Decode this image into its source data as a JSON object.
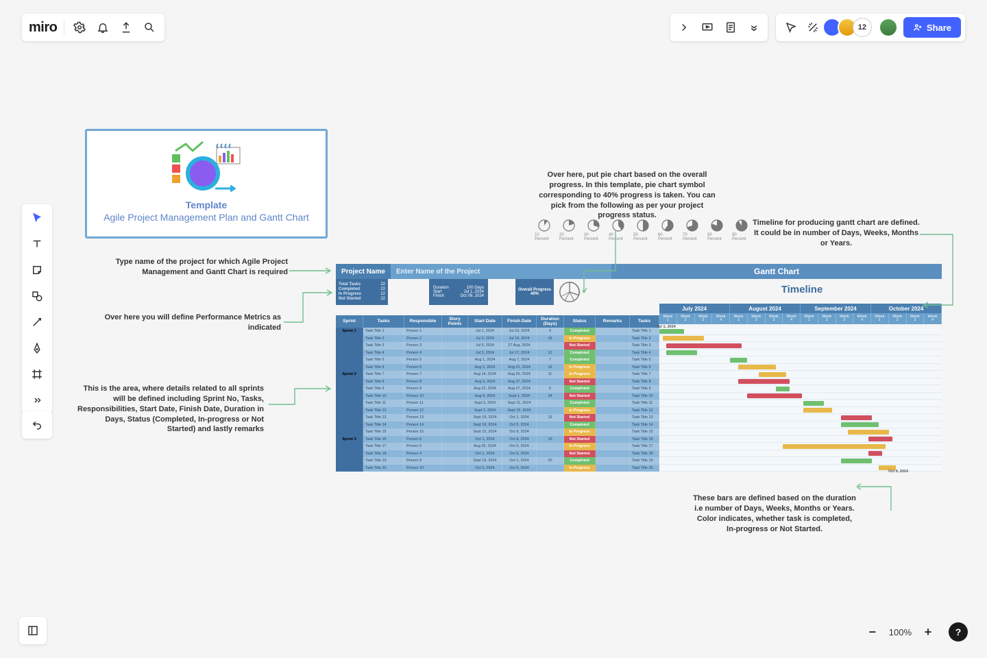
{
  "header": {
    "logo": "miro",
    "share_label": "Share",
    "avatar_overflow": "12"
  },
  "zoom": {
    "percent": "100%"
  },
  "template_card": {
    "title": "Template",
    "subtitle": "Agile Project Management Plan and Gantt Chart"
  },
  "annotations": {
    "project_name": "Type name of the project for which Agile Project Management and Gantt Chart is required",
    "metrics": "Over here you will define Performance Metrics as indicated",
    "sprints": "This is the area, where details related to all sprints will be defined including Sprint No, Tasks, Responsibilities, Start Date, Finish Date, Duration in Days, Status (Completed, In-progress or Not Started) and lastly remarks",
    "pie": "Over here, put pie chart based on the overall progress. In this template, pie chart symbol corresponding to 40% progress is taken. You can pick from the following as per your project progress status.",
    "timeline": "Timeline for producing gantt chart are defined. It could be in number of Days, Weeks, Months or Years.",
    "bars": "These bars are defined based on the duration i.e number of Days, Weeks, Months or Years. Color indicates, whether task is completed, In-progress or Not Started."
  },
  "pie_labels": [
    "10 Percent",
    "20 Percent",
    "30 Percent",
    "40 Percent",
    "50 Percent",
    "60 Percent",
    "70 Percent",
    "80 Percent",
    "90 Percent"
  ],
  "gantt": {
    "project_name_label": "Project Name",
    "project_name_placeholder": "Enter Name of the Project",
    "chart_label": "Gantt Chart",
    "timeline_label": "Timeline",
    "metrics": {
      "total_tasks": {
        "label": "Total Tasks",
        "value": "22"
      },
      "completed": {
        "label": "Completed",
        "value": "22"
      },
      "in_progress": {
        "label": "In Progress",
        "value": "22"
      },
      "not_started": {
        "label": "Not Started",
        "value": "22"
      }
    },
    "duration": {
      "label": "Duration",
      "value": "100 Days",
      "start_l": "Start",
      "start_v": "Jul 1, 2024",
      "finish_l": "Finish",
      "finish_v": "Oct 09, 2024"
    },
    "overall": {
      "label": "Overall Progress",
      "value": "40%"
    },
    "months": [
      {
        "label": "July 2024",
        "weeks": 4
      },
      {
        "label": "August 2024",
        "weeks": 4
      },
      {
        "label": "September 2024",
        "weeks": 4
      },
      {
        "label": "October 2024",
        "weeks": 4
      }
    ],
    "week_labels": [
      "Week 1",
      "Week 2",
      "Week 3",
      "Week 4",
      "Week 1",
      "Week 2",
      "Week 3",
      "Week 4",
      "Week 1",
      "Week 2",
      "Week 3",
      "Week 4",
      "Week 1",
      "Week 2",
      "Week 3",
      "Week 4"
    ],
    "columns": [
      "Sprint",
      "Tasks",
      "Responsible",
      "Story Points",
      "Start Date",
      "Finish Date",
      "Duration (Days)",
      "Status",
      "Remarks",
      "Tasks"
    ],
    "start_tag": "Jul 1, 2024",
    "end_tag": "Oct 9, 2024",
    "rows": [
      {
        "sprint": "Sprint 1",
        "task": "Task Title 1",
        "resp": "Person 1",
        "sp": "",
        "sd": "Jul 1, 2024",
        "fd": "Jul 10, 2024",
        "dur": "9",
        "status": "Completed",
        "tl": "Task Title 1",
        "bar": [
          0,
          36,
          "comp"
        ]
      },
      {
        "sprint": "",
        "task": "Task Title 2",
        "resp": "Person 2",
        "sp": "",
        "sd": "Jul 3, 2024",
        "fd": "Jul 19, 2024",
        "dur": "16",
        "status": "In Progress",
        "tl": "Task Title 2",
        "bar": [
          5,
          60,
          "prog"
        ]
      },
      {
        "sprint": "",
        "task": "Task Title 3",
        "resp": "Person 3",
        "sp": "",
        "sd": "Jul 5, 2024",
        "fd": "27 Aug, 2024",
        "dur": "",
        "status": "Not Started",
        "tl": "Task Title 3",
        "bar": [
          10,
          110,
          "not"
        ]
      },
      {
        "sprint": "",
        "task": "Task Title 4",
        "resp": "Person 4",
        "sp": "",
        "sd": "Jul 5, 2024",
        "fd": "Jul 17, 2024",
        "dur": "12",
        "status": "Completed",
        "tl": "Task Title 4",
        "bar": [
          10,
          45,
          "comp"
        ]
      },
      {
        "sprint": "",
        "task": "Task Title 5",
        "resp": "Person 5",
        "sp": "",
        "sd": "Aug 1, 2024",
        "fd": "Aug 7, 2024",
        "dur": "7",
        "status": "Completed",
        "tl": "Task Title 5",
        "bar": [
          103,
          25,
          "comp"
        ]
      },
      {
        "sprint": "",
        "task": "Task Title 6",
        "resp": "Person 6",
        "sp": "",
        "sd": "Aug 5, 2024",
        "fd": "Aug 21, 2024",
        "dur": "16",
        "status": "In Progress",
        "tl": "Task Title 6",
        "bar": [
          115,
          55,
          "prog"
        ]
      },
      {
        "sprint": "Sprint 2",
        "task": "Task Title 7",
        "resp": "Person 7",
        "sp": "",
        "sd": "Aug 14, 2024",
        "fd": "Aug 25, 2024",
        "dur": "11",
        "status": "In Progress",
        "tl": "Task Title 7",
        "bar": [
          145,
          40,
          "prog"
        ]
      },
      {
        "sprint": "",
        "task": "Task Title 8",
        "resp": "Person 8",
        "sp": "",
        "sd": "Aug 5, 2024",
        "fd": "Aug 27, 2024",
        "dur": "",
        "status": "Not Started",
        "tl": "Task Title 8",
        "bar": [
          115,
          75,
          "not"
        ]
      },
      {
        "sprint": "",
        "task": "Task Title 9",
        "resp": "Person 9",
        "sp": "",
        "sd": "Aug 22, 2024",
        "fd": "Aug 27, 2024",
        "dur": "5",
        "status": "Completed",
        "tl": "Task Title 9",
        "bar": [
          170,
          20,
          "comp"
        ]
      },
      {
        "sprint": "",
        "task": "Task Title 10",
        "resp": "Person 10",
        "sp": "",
        "sd": "Aug 9, 2024",
        "fd": "Sept 1, 2024",
        "dur": "24",
        "status": "Not Started",
        "tl": "Task Title 10",
        "bar": [
          128,
          80,
          "not"
        ]
      },
      {
        "sprint": "",
        "task": "Task Title 11",
        "resp": "Person 11",
        "sp": "",
        "sd": "Sept 3, 2024",
        "fd": "Sept 11, 2024",
        "dur": "",
        "status": "Completed",
        "tl": "Task Title 11",
        "bar": [
          210,
          30,
          "comp"
        ]
      },
      {
        "sprint": "",
        "task": "Task Title 12",
        "resp": "Person 12",
        "sp": "",
        "sd": "Sept 3, 2024",
        "fd": "Sept 15, 2024",
        "dur": "",
        "status": "In Progress",
        "tl": "Task Title 12",
        "bar": [
          210,
          42,
          "prog"
        ]
      },
      {
        "sprint": "",
        "task": "Task Title 13",
        "resp": "Person 13",
        "sp": "",
        "sd": "Sept 19, 2024",
        "fd": "Oct 1, 2024",
        "dur": "13",
        "status": "Not Started",
        "tl": "Task Title 13",
        "bar": [
          265,
          45,
          "not"
        ]
      },
      {
        "sprint": "",
        "task": "Task Title 14",
        "resp": "Person 14",
        "sp": "",
        "sd": "Sept 19, 2024",
        "fd": "Oct 5, 2024",
        "dur": "",
        "status": "Completed",
        "tl": "Task Title 14",
        "bar": [
          265,
          55,
          "comp"
        ]
      },
      {
        "sprint": "",
        "task": "Task Title 15",
        "resp": "Person 15",
        "sp": "",
        "sd": "Sept 22, 2024",
        "fd": "Oct 9, 2024",
        "dur": "",
        "status": "In Progress",
        "tl": "Task Title 15",
        "bar": [
          275,
          60,
          "prog"
        ]
      },
      {
        "sprint": "Sprint 3",
        "task": "Task Title 16",
        "resp": "Person 6",
        "sp": "",
        "sd": "Oct 1, 2024",
        "fd": "Oct 9, 2024",
        "dur": "10",
        "status": "Not Started",
        "tl": "Task Title 16",
        "bar": [
          305,
          35,
          "not"
        ]
      },
      {
        "sprint": "",
        "task": "Task Title 17",
        "resp": "Person 5",
        "sp": "",
        "sd": "Aug 25, 2024",
        "fd": "Oct 5, 2024",
        "dur": "",
        "status": "In Progress",
        "tl": "Task Title 17",
        "bar": [
          180,
          150,
          "prog"
        ]
      },
      {
        "sprint": "",
        "task": "Task Title 18",
        "resp": "Person 4",
        "sp": "",
        "sd": "Oct 1, 2024",
        "fd": "Oct 5, 2024",
        "dur": "",
        "status": "Not Started",
        "tl": "Task Title 18",
        "bar": [
          305,
          20,
          "not"
        ]
      },
      {
        "sprint": "",
        "task": "Task Title 19",
        "resp": "Person 8",
        "sp": "",
        "sd": "Sept 19, 2024",
        "fd": "Oct 1, 2024",
        "dur": "20",
        "status": "Completed",
        "tl": "Task Title 19",
        "bar": [
          265,
          45,
          "comp"
        ]
      },
      {
        "sprint": "",
        "task": "Task Title 20",
        "resp": "Person 10",
        "sp": "",
        "sd": "Oct 5, 2024",
        "fd": "Oct 9, 2024",
        "dur": "",
        "status": "In Progress",
        "tl": "Task Title 20",
        "bar": [
          320,
          25,
          "prog"
        ]
      }
    ]
  }
}
